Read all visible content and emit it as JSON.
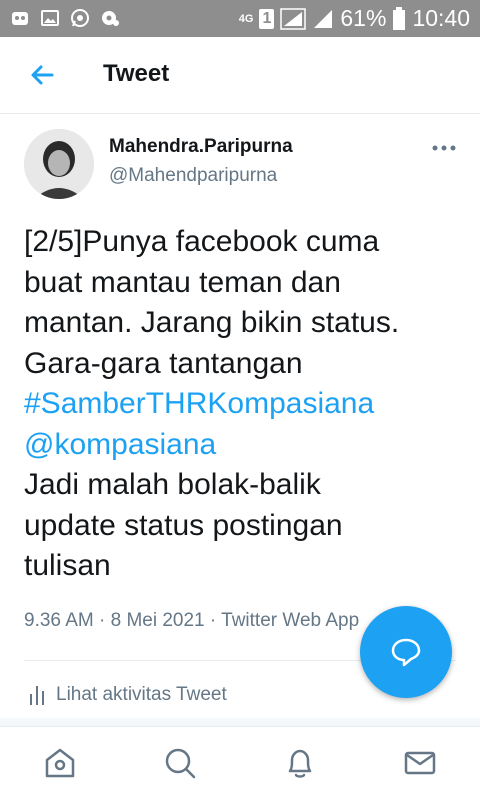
{
  "status_bar": {
    "network": "4G",
    "sim": "1",
    "battery": "61%",
    "time": "10:40"
  },
  "header": {
    "title": "Tweet"
  },
  "author": {
    "name": "Mahendra.Paripurna",
    "handle": "@Mahendparipurna"
  },
  "tweet": {
    "lines": [
      "[2/5]Punya facebook cuma",
      "buat mantau teman dan",
      "mantan. Jarang  bikin status.",
      "Gara-gara tantangan",
      "#SamberTHRKompasiana",
      "@kompasiana",
      "Jadi malah bolak-balik",
      "update status postingan",
      "tulisan"
    ],
    "meta": "9.36 AM · 8 Mei 2021 · Twitter Web App"
  },
  "activity": {
    "label": "Lihat aktivitas Tweet"
  },
  "colors": {
    "accent": "#1da1f2",
    "secondary_text": "#657786",
    "status_bar": "#8e8e8e"
  },
  "icons": {
    "header": "back-arrow-icon",
    "more": "more-dots-icon",
    "fab": "reply-bubble-icon",
    "nav": [
      "home-icon",
      "search-icon",
      "notifications-bell-icon",
      "messages-mail-icon"
    ]
  }
}
